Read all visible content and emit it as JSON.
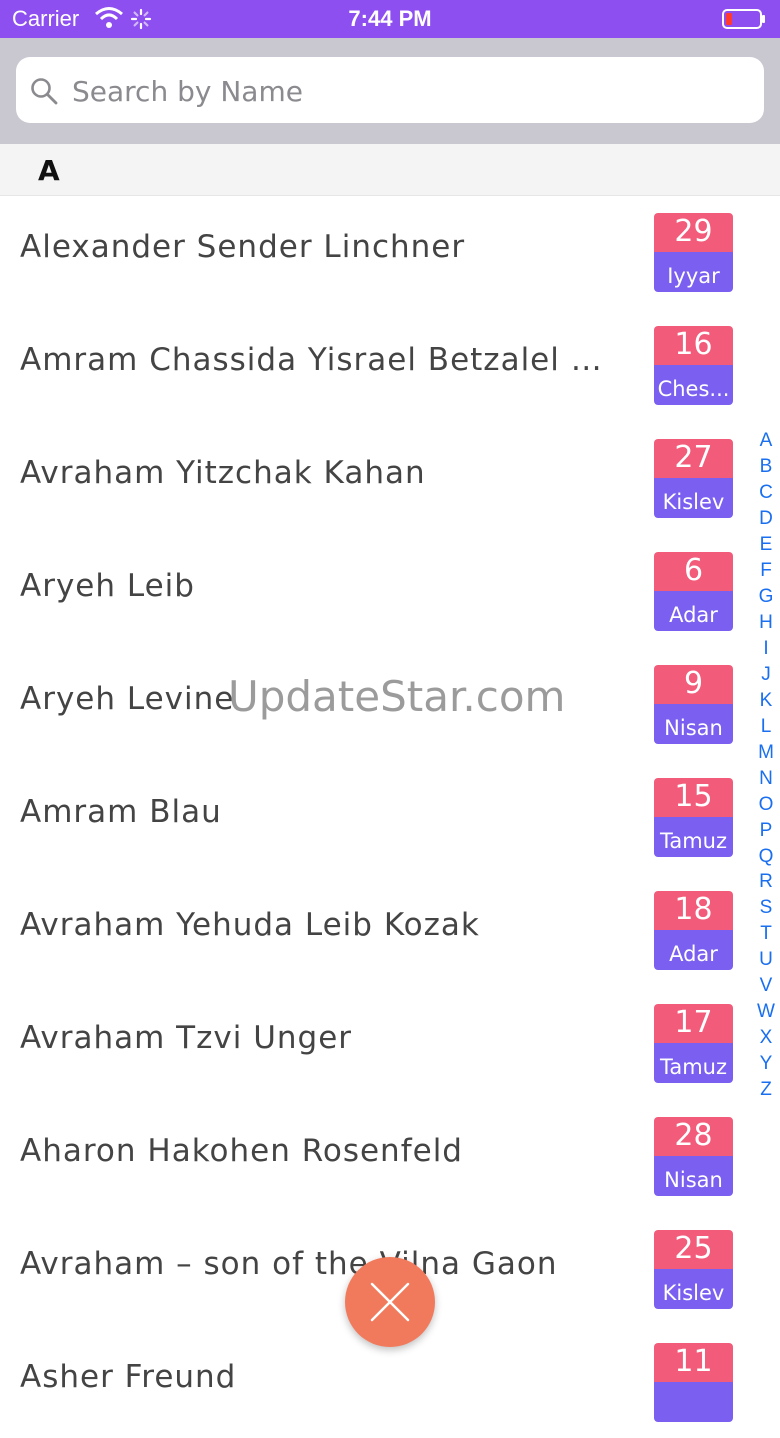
{
  "status_bar": {
    "carrier": "Carrier",
    "time": "7:44 PM"
  },
  "search": {
    "placeholder": "Search by Name",
    "value": ""
  },
  "section": {
    "title": "A"
  },
  "rows": [
    {
      "name": "Alexander Sender Linchner",
      "day": "29",
      "month": "Iyyar"
    },
    {
      "name": "Amram Chassida Yisrael Betzalel Ro...",
      "day": "16",
      "month": "Ches..."
    },
    {
      "name": "Avraham Yitzchak Kahan",
      "day": "27",
      "month": "Kislev"
    },
    {
      "name": "Aryeh Leib",
      "day": "6",
      "month": "Adar"
    },
    {
      "name": "Aryeh Levine",
      "day": "9",
      "month": "Nisan"
    },
    {
      "name": "Amram Blau",
      "day": "15",
      "month": "Tamuz"
    },
    {
      "name": "Avraham Yehuda Leib Kozak",
      "day": "18",
      "month": "Adar"
    },
    {
      "name": "Avraham Tzvi Unger",
      "day": "17",
      "month": "Tamuz"
    },
    {
      "name": "Aharon Hakohen Rosenfeld",
      "day": "28",
      "month": "Nisan"
    },
    {
      "name": "Avraham – son of the Vilna Gaon",
      "day": "25",
      "month": "Kislev"
    },
    {
      "name": "Asher Freund",
      "day": "11",
      "month": ""
    }
  ],
  "index_letters": [
    "A",
    "B",
    "C",
    "D",
    "E",
    "F",
    "G",
    "H",
    "I",
    "J",
    "K",
    "L",
    "M",
    "N",
    "O",
    "P",
    "Q",
    "R",
    "S",
    "T",
    "U",
    "V",
    "W",
    "X",
    "Y",
    "Z"
  ],
  "watermark": "UpdateStar.com",
  "colors": {
    "status_bar": "#8e4ff0",
    "badge_day": "#f25b7a",
    "badge_month": "#7a5ff0",
    "index_letter": "#1a6ff0",
    "fab": "#f27a5c"
  }
}
